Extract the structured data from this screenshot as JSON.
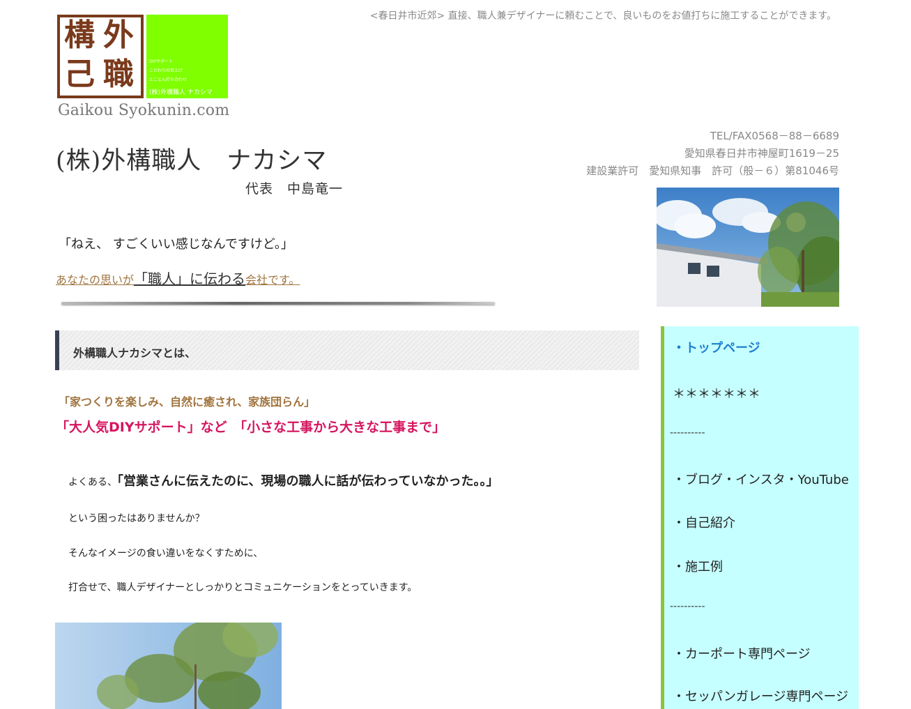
{
  "header": {
    "tagline": "<春日井市近郊> 直接、職人兼デザイナーに頼むことで、良いものをお値打ちに施工することができます。",
    "logo": {
      "seal_glyphs": [
        "構",
        "外",
        "己",
        "職"
      ],
      "green_small_lines": [
        "DIYサポート",
        "こだわりの目上げ",
        "とことん打ち合わせ"
      ],
      "green_brand": "(株)外構職人 ナカシマ",
      "text": "Gaikou Syokunin.com"
    },
    "company_name": "(株)外構職人　ナカシマ",
    "representative": "代表　中島竜一",
    "contact": {
      "tel": "TEL/FAX0568－88－6689",
      "address": "愛知県春日井市神屋町1619－25",
      "license": "建設業許可　愛知県知事　許可（般－６）第81046号"
    }
  },
  "hero": {
    "quote": "「ねえ、 すごくいい感じなんですけど。」",
    "slogan_part1": "あなたの思いが",
    "slogan_part2": "「職人」に伝わる",
    "slogan_part3": "会社です。"
  },
  "main": {
    "section_title": "外構職人ナカシマとは、",
    "lead1": "「家つくりを楽しみ、自然に癒され、家族団らん」",
    "lead2": "「大人気DIYサポート」など　「小さな工事から大きな工事まで」",
    "p1_prefix": "よくある、",
    "p1_emph": "「営業さんに伝えたのに、現場の職人に話が伝わっていなかった。。」",
    "p2": "という困ったはありませんか？",
    "p3": "そんなイメージの食い違いをなくすために、",
    "p4": "打合せで、職人デザイナーとしっかりとコミュニケーションをとっていきます。"
  },
  "sidebar": {
    "items": [
      {
        "label": "・トップページ"
      },
      {
        "label": "＊＊＊＊＊＊＊"
      },
      {
        "label": "----------"
      },
      {
        "label": "・ブログ・インスタ・YouTube"
      },
      {
        "label": "・自己紹介"
      },
      {
        "label": "・施工例"
      },
      {
        "label": "----------"
      },
      {
        "label": "・カーポート専門ページ"
      },
      {
        "label": "・セッパンガレージ専門ページ"
      }
    ]
  },
  "colors": {
    "accent_green": "#7fff00",
    "seal_brown": "#7a3a1c",
    "lead_brown": "#a0743e",
    "lead_pink": "#d6145f",
    "sidebar_bg": "#c6ffff",
    "sidebar_border": "#8bc33a",
    "link_blue": "#1e7fd1"
  }
}
